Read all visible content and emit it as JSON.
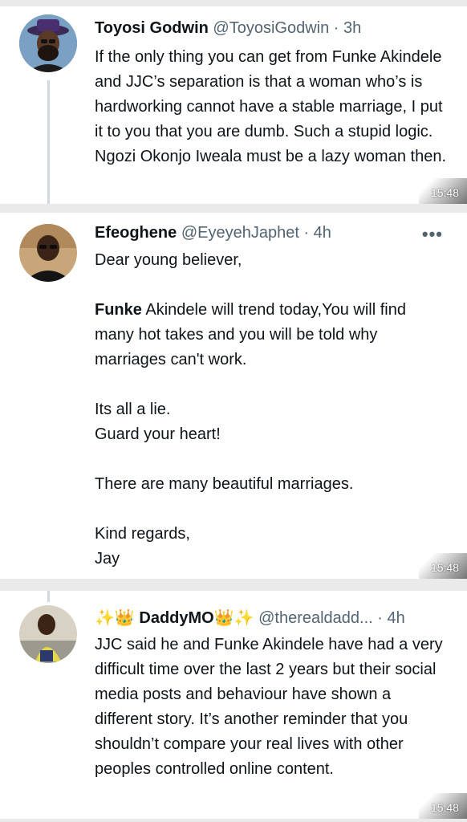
{
  "tweets": [
    {
      "name": "Toyosi Godwin",
      "handle": "@ToyosiGodwin",
      "dot": "·",
      "time": "3h",
      "text": "If the only thing you can get from Funke Akindele and JJC’s separation is that a woman who’s is hardworking cannot have a stable marriage, I put it to you that you are dumb. Such a stupid logic. Ngozi Okonjo Iweala must be a lazy woman then.",
      "stamp": "15:48"
    },
    {
      "name": "Efeoghene",
      "handle": "@EyeyehJaphet",
      "dot": "·",
      "time": "4h",
      "more": "•••",
      "text_line1": "Dear young believer,",
      "text_bold": "Funke",
      "text_after_bold": " Akindele will trend today,You will find many hot takes and you will be told why marriages can't work.",
      "text_rest": "Its all a lie.\nGuard your heart!\n\nThere are many beautiful marriages.\n\nKind regards,\nJay",
      "stamp": "15:48"
    },
    {
      "name_prefix": "✨👑",
      "name": "DaddyMO",
      "name_suffix": "👑✨",
      "handle": "@therealdadd...",
      "dot": "·",
      "time": "4h",
      "text": "JJC said he and Funke Akindele have had a very difficult time over the last 2 years but their social media posts and behaviour have shown a different story. It’s another reminder that you shouldn’t compare your real lives with other peoples controlled online content.",
      "stamp": "15:48"
    }
  ],
  "colors": {
    "background": "#eaeaea",
    "card": "#ffffff",
    "text": "#0f1419",
    "muted": "#536471",
    "thread_line": "#cfd9de"
  },
  "icons": [
    "avatar-toyosi",
    "avatar-efeoghene",
    "avatar-daddymo",
    "more-icon",
    "sparkle-icon",
    "crown-icon"
  ]
}
